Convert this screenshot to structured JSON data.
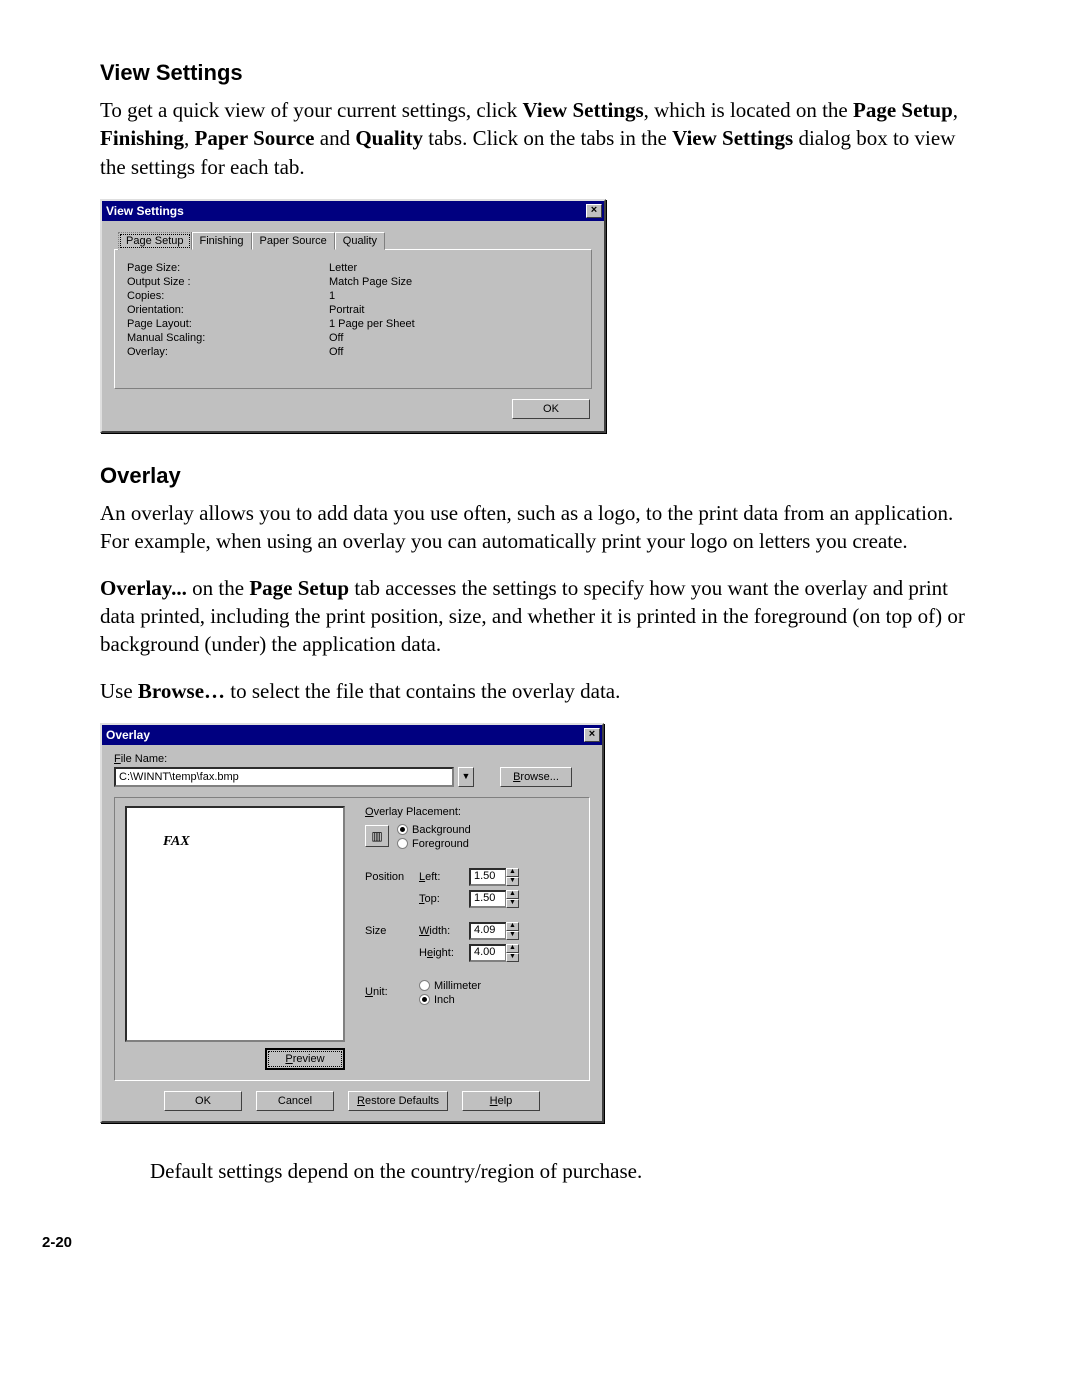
{
  "section1": {
    "title": "View Settings",
    "para": "To get a quick view of your current settings, click <b>View Settings</b>, which is located on the <b>Page Setup</b>, <b>Finishing</b>, <b>Paper Source</b> and <b>Quality</b> tabs. Click on the tabs in the <b>View Settings</b> dialog box to view the settings for each tab."
  },
  "viewSettingsDlg": {
    "title": "View Settings",
    "close": "×",
    "tabs": [
      "Page Setup",
      "Finishing",
      "Paper Source",
      "Quality"
    ],
    "activeTab": 0,
    "rows": [
      {
        "k": "Page Size:",
        "v": "Letter"
      },
      {
        "k": "Output Size :",
        "v": "Match Page Size"
      },
      {
        "k": "Copies:",
        "v": "1"
      },
      {
        "k": "Orientation:",
        "v": "Portrait"
      },
      {
        "k": "Page Layout:",
        "v": "1 Page per Sheet"
      },
      {
        "k": "Manual Scaling:",
        "v": "Off"
      },
      {
        "k": "Overlay:",
        "v": "Off"
      }
    ],
    "ok": "OK"
  },
  "section2": {
    "title": "Overlay",
    "p1": "An overlay allows you to add data you use often, such as a logo, to the print data from an application. For example, when using an overlay you can automatically print your logo on letters you create.",
    "p2": "<b>Overlay...</b> on the <b>Page Setup</b> tab accesses the settings to specify how you want the overlay and print data printed, including the print position, size, and whether it is printed in the foreground (on top of) or background (under) the application data.",
    "p3": "Use <b>Browse…</b> to select the file that contains the overlay data."
  },
  "overlayDlg": {
    "title": "Overlay",
    "close": "×",
    "fileNameLabel": "File Name:",
    "fileName": "C:\\WINNT\\temp\\fax.bmp",
    "browse": "Browse...",
    "previewLabel": "FAX",
    "previewBtn": "Preview",
    "placementLabel": "Overlay Placement:",
    "bg": "Background",
    "fg": "Foreground",
    "positionLabel": "Position",
    "leftLabel": "Left:",
    "topLabel": "Top:",
    "left": "1.50",
    "top": "1.50",
    "sizeLabel": "Size",
    "widthLabel": "Width:",
    "heightLabel": "Height:",
    "width": "4.09",
    "height": "4.00",
    "unitLabel": "Unit:",
    "mm": "Millimeter",
    "inch": "Inch",
    "ok": "OK",
    "cancel": "Cancel",
    "restore": "Restore Defaults",
    "help": "Help"
  },
  "caption": "Default settings depend on the country/region of purchase.",
  "pageNum": "2-20"
}
